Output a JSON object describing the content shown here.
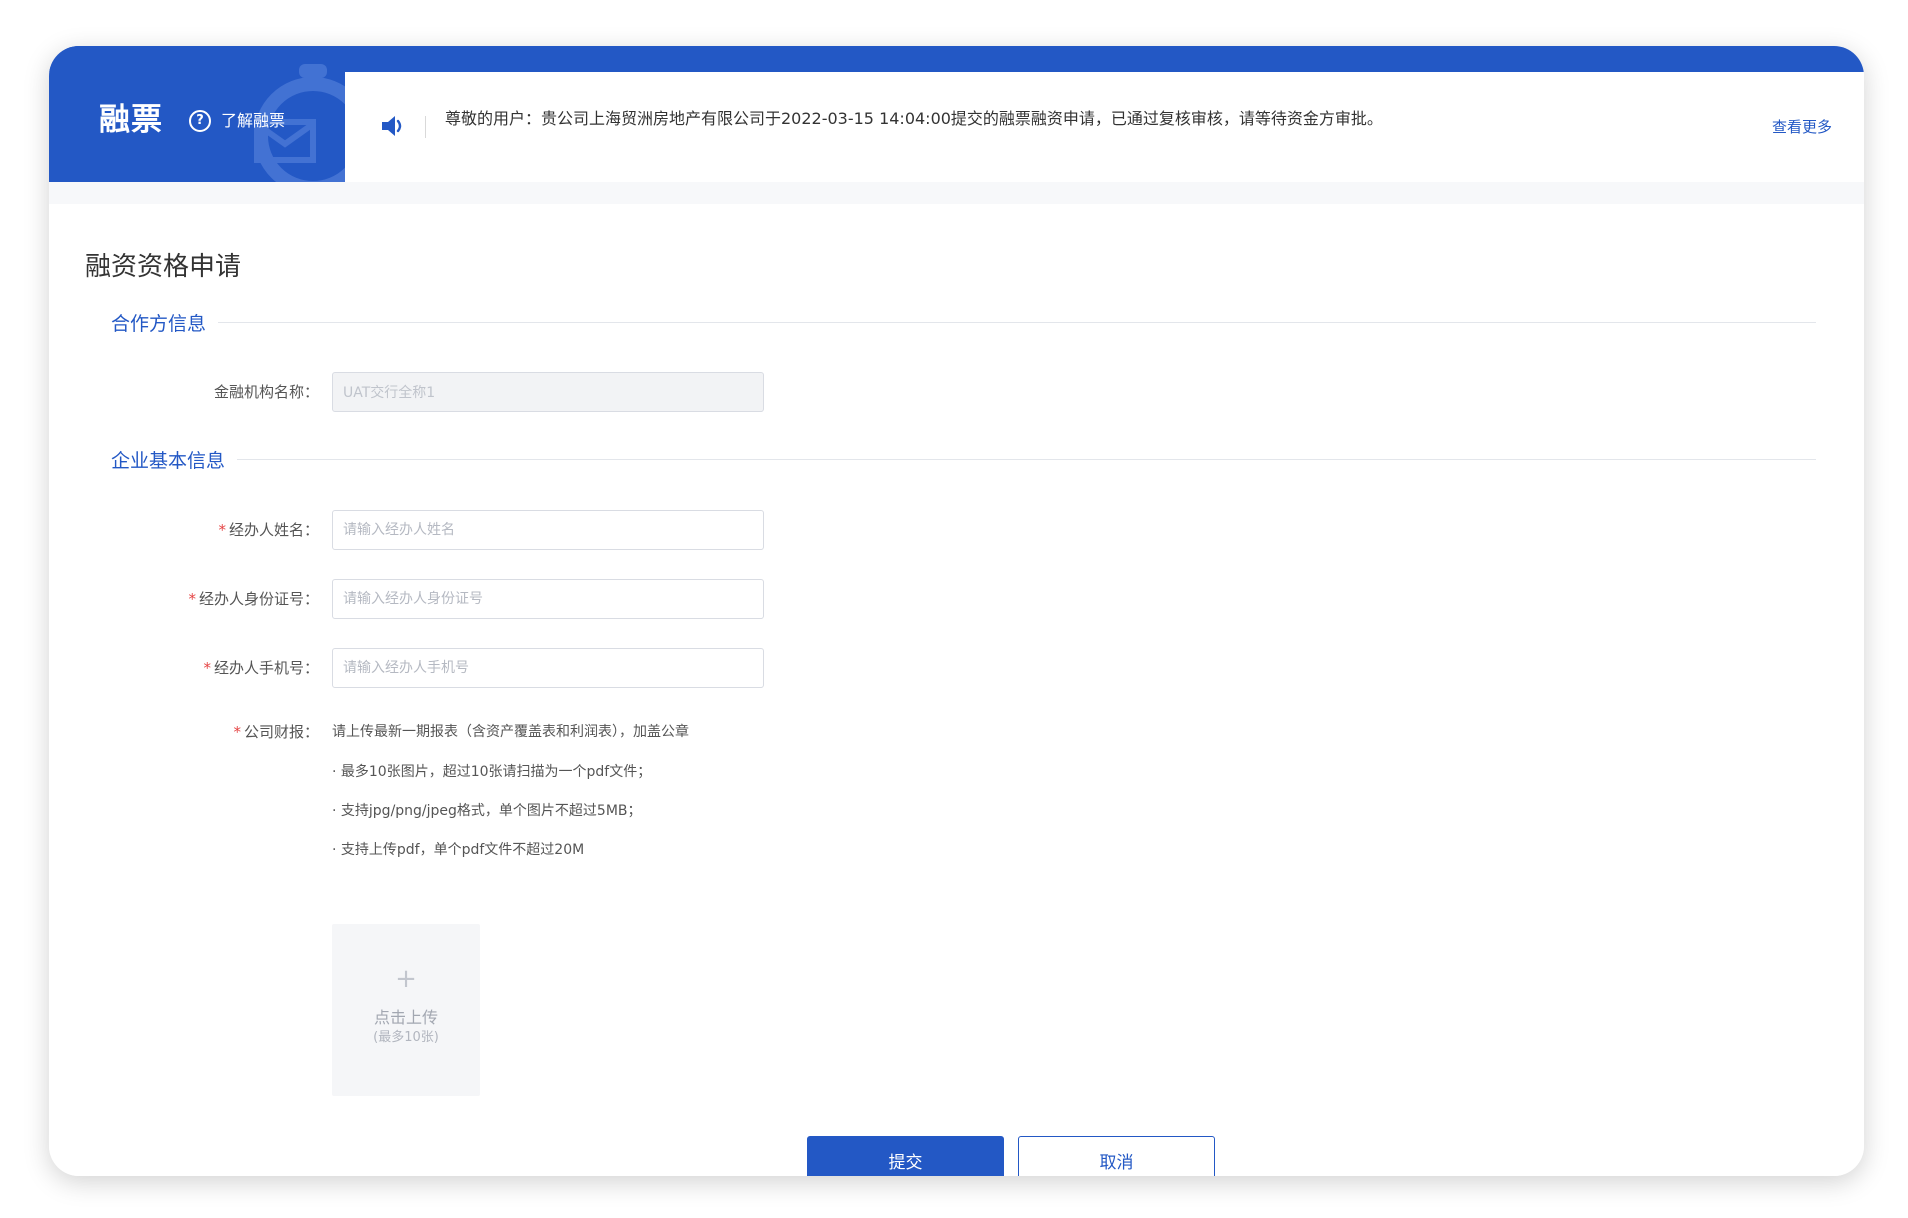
{
  "brand": {
    "title": "融票",
    "help_icon_glyph": "?",
    "help_link": "了解融票"
  },
  "notice": {
    "text": "尊敬的用户：贵公司上海贸洲房地产有限公司于2022-03-15 14:04:00提交的融票融资申请，已通过复核审核，请等待资金方审批。",
    "view_more": "查看更多"
  },
  "page": {
    "title": "融资资格申请"
  },
  "sections": {
    "partner": {
      "title": "合作方信息",
      "fields": {
        "institution": {
          "label": "金融机构名称：",
          "value": "UAT交行全称1"
        }
      }
    },
    "enterprise": {
      "title": "企业基本信息",
      "required_mark": "*",
      "fields": {
        "agent_name": {
          "label": "经办人姓名：",
          "placeholder": "请输入经办人姓名"
        },
        "agent_id": {
          "label": "经办人身份证号：",
          "placeholder": "请输入经办人身份证号"
        },
        "agent_phone": {
          "label": "经办人手机号：",
          "placeholder": "请输入经办人手机号"
        },
        "financials": {
          "label": "公司财报：",
          "desc": "请上传最新一期报表（含资产覆盖表和利润表），加盖公章",
          "rules": [
            "· 最多10张图片，超过10张请扫描为一个pdf文件；",
            "· 支持jpg/png/jpeg格式，单个图片不超过5MB；",
            "· 支持上传pdf，单个pdf文件不超过20M"
          ]
        }
      }
    }
  },
  "upload": {
    "plus": "+",
    "label": "点击上传",
    "sub": "(最多10张)"
  },
  "actions": {
    "submit": "提交",
    "cancel": "取消"
  },
  "colors": {
    "brand": "#2358c5",
    "required": "#e54545"
  }
}
